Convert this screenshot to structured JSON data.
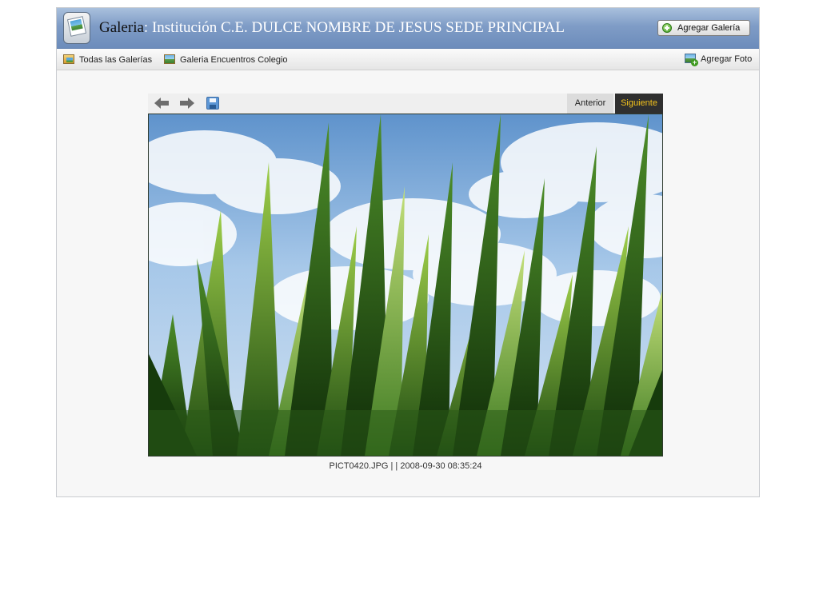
{
  "header": {
    "label": "Galeria",
    "separator": ": ",
    "title": "Institución C.E. DULCE NOMBRE DE JESUS SEDE PRINCIPAL",
    "add_gallery_label": "Agregar Galería"
  },
  "nav": {
    "all_galleries": "Todas las Galerías",
    "current_gallery": "Galeria Encuentros Colegio",
    "add_photo": "Agregar Foto"
  },
  "viewer": {
    "prev_label": "Anterior",
    "next_label": "Siguiente",
    "next_color": "#f3c21c",
    "caption": "PICT0420.JPG |  | 2008-09-30 08:35:24",
    "photo_subject": "grass-blades-against-blue-sky"
  },
  "icons": {
    "logo": "gallery-logo-icon",
    "add": "plus-circle-icon",
    "prev": "arrow-left-icon",
    "next": "arrow-right-icon",
    "save": "save-icon"
  }
}
